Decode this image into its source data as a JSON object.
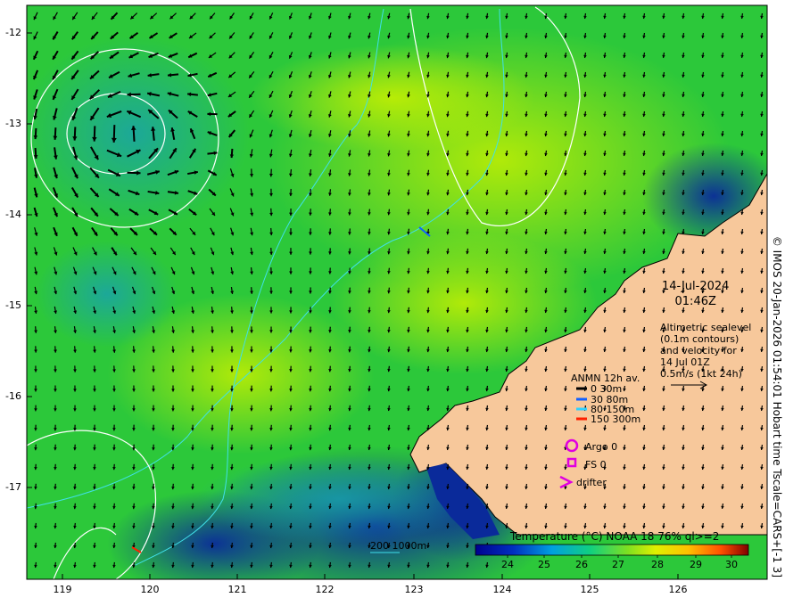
{
  "map": {
    "lon_ticks": [
      "119",
      "120",
      "121",
      "122",
      "123",
      "124",
      "125",
      "126"
    ],
    "lat_ticks": [
      "-12",
      "-13",
      "-14",
      "-15",
      "-16",
      "-17"
    ]
  },
  "timestamp": {
    "date": "14-Jul-2024",
    "time": "01:46Z"
  },
  "altimetry_note": {
    "lines": [
      "Altimetric sealevel",
      "(0.1m contours)",
      "and velocity for",
      "14 Jul 01Z",
      "0.5m/s (1kt 24h)"
    ]
  },
  "anmn_legend": {
    "title": "ANMN 12h av.",
    "rows": [
      {
        "label": "0 30m",
        "color": "#000000"
      },
      {
        "label": "30 80m",
        "color": "#1060ff"
      },
      {
        "label": "80 150m",
        "color": "#30d0ff"
      },
      {
        "label": "150 300m",
        "color": "#ff2000"
      }
    ]
  },
  "platforms": {
    "argo": "Argo 0",
    "fs": "FS 0",
    "drifter": "drifter"
  },
  "bathymetry": {
    "label": "200  1000m"
  },
  "colorbar": {
    "title": "Temperature (°C) NOAA 18 76% ql>=2",
    "ticks": [
      "24",
      "25",
      "26",
      "27",
      "28",
      "29",
      "30"
    ]
  },
  "credit": "© IMOS 20-Jan-2026 01:54:01 Hobart time Tscale=CARS+[-1 3]",
  "colors": {
    "land": "#f7c89b",
    "sst_cool": "#0a2a9a",
    "sst_mid": "#1fc84a",
    "sst_warm": "#c8f000",
    "isobath": "#40e0e8"
  }
}
